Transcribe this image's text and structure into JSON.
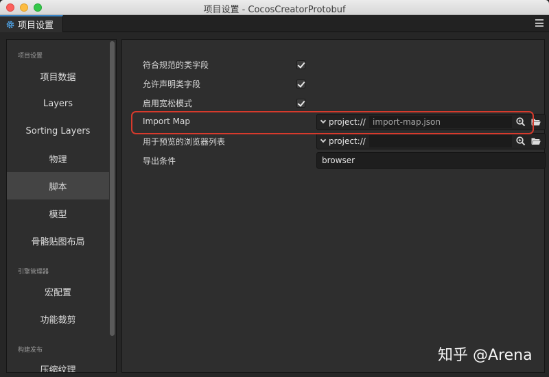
{
  "window": {
    "title": "项目设置 - CocosCreatorProtobuf"
  },
  "tab": {
    "label": "项目设置",
    "icon": "gear-icon"
  },
  "sidebar": {
    "sections": [
      {
        "title": "项目设置",
        "items": [
          "项目数据",
          "Layers",
          "Sorting Layers",
          "物理",
          "脚本",
          "模型",
          "骨骼贴图布局"
        ]
      },
      {
        "title": "引擎管理器",
        "items": [
          "宏配置",
          "功能裁剪"
        ]
      },
      {
        "title": "构建发布",
        "items": [
          "压缩纹理"
        ]
      }
    ],
    "active_item": "脚本"
  },
  "settings": {
    "rows": [
      {
        "label": "符合规范的类字段",
        "type": "checkbox",
        "checked": true
      },
      {
        "label": "允许声明类字段",
        "type": "checkbox",
        "checked": true
      },
      {
        "label": "启用宽松模式",
        "type": "checkbox",
        "checked": true
      },
      {
        "label": "Import Map",
        "type": "path",
        "protocol": "project://",
        "value": "import-map.json"
      },
      {
        "label": "用于预览的浏览器列表",
        "type": "path",
        "protocol": "project://",
        "value": ""
      },
      {
        "label": "导出条件",
        "type": "text",
        "value": "browser"
      }
    ]
  },
  "highlight_color": "#d73a2c",
  "accent_color": "#3a86c9",
  "watermark": "知乎 @Arena"
}
